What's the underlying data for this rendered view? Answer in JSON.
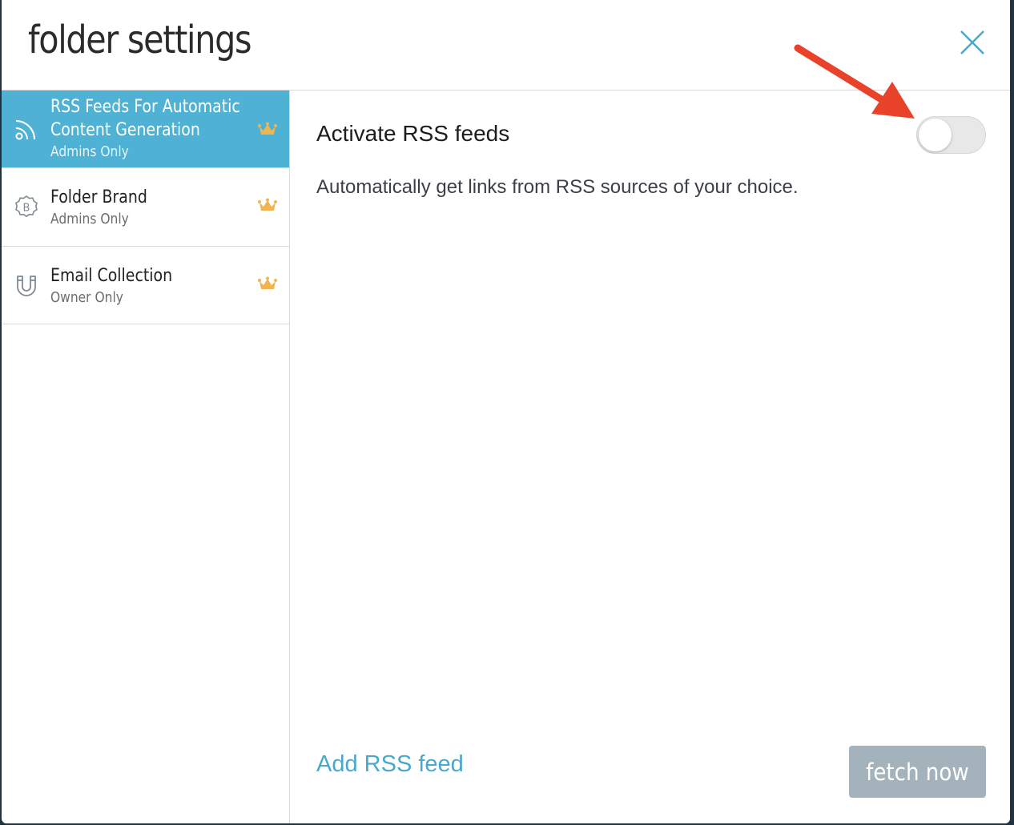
{
  "dialog": {
    "title": "folder settings",
    "close_icon": "close-icon"
  },
  "sidebar": {
    "items": [
      {
        "label_line1": "RSS Feeds For Automatic",
        "label_line2": "Content Generation",
        "sub": "Admins Only",
        "icon": "rss-icon",
        "active": true,
        "badge_icon": "crown-icon"
      },
      {
        "label": "Folder Brand",
        "sub": "Admins Only",
        "icon": "brand-badge-icon",
        "active": false,
        "badge_icon": "crown-icon"
      },
      {
        "label": "Email Collection",
        "sub": "Owner Only",
        "icon": "magnet-icon",
        "active": false,
        "badge_icon": "crown-icon"
      }
    ]
  },
  "content": {
    "toggle_label": "Activate RSS feeds",
    "toggle_on": false,
    "description": "Automatically get links from RSS sources of your choice.",
    "add_link": "Add RSS feed",
    "fetch_button": "fetch now"
  },
  "colors": {
    "accent": "#4fb1d4",
    "link": "#4aa8cb",
    "crown": "#f0b450",
    "fetch_button_bg": "#a4b3bb",
    "annotation_arrow": "#e8432a"
  }
}
